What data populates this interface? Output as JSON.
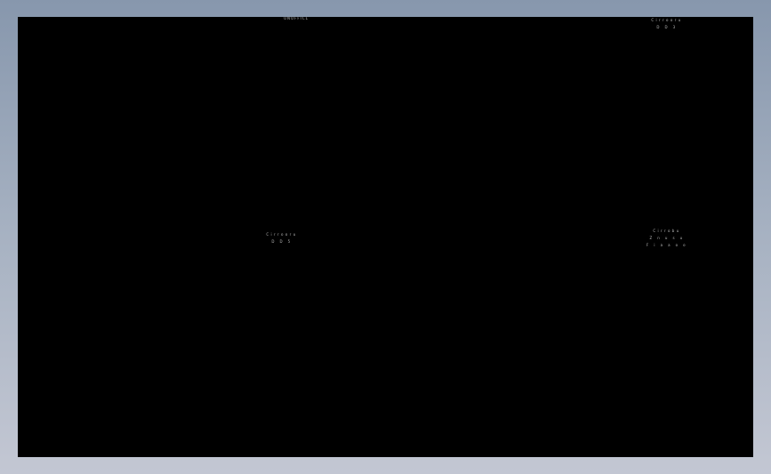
{
  "viewport": {
    "title": "UNOFFICL",
    "annotations": [
      {
        "lines": [
          "Cirrooru",
          "D D 3"
        ]
      },
      {
        "lines": [
          "Cirrooru",
          "D D 5"
        ]
      },
      {
        "lines": [
          "Cirrobu",
          "Z n u s u",
          "F i a a o o"
        ]
      }
    ]
  }
}
